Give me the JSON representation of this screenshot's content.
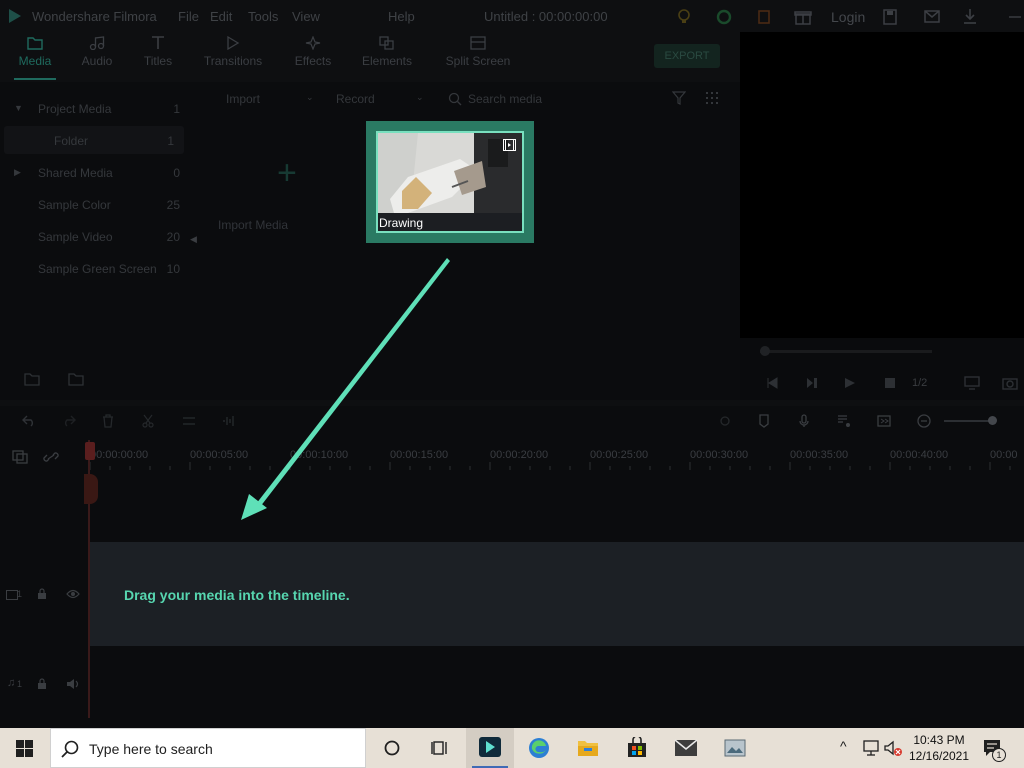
{
  "app": {
    "name": "Wondershare Filmora",
    "menu": [
      "File",
      "Edit",
      "Tools",
      "View",
      "Help"
    ],
    "document_title": "Untitled : 00:00:00:00",
    "login_label": "Login"
  },
  "tabs": [
    {
      "label": "Media",
      "icon": "folder-icon",
      "active": true
    },
    {
      "label": "Audio",
      "icon": "music-icon",
      "active": false
    },
    {
      "label": "Titles",
      "icon": "text-icon",
      "active": false
    },
    {
      "label": "Transitions",
      "icon": "transition-icon",
      "active": false
    },
    {
      "label": "Effects",
      "icon": "effects-icon",
      "active": false
    },
    {
      "label": "Elements",
      "icon": "elements-icon",
      "active": false
    },
    {
      "label": "Split Screen",
      "icon": "split-screen-icon",
      "active": false
    }
  ],
  "export_label": "EXPORT",
  "media_panel": {
    "items": [
      {
        "label": "Project Media",
        "count": "1"
      },
      {
        "label": "Folder",
        "count": "1"
      },
      {
        "label": "Shared Media",
        "count": "0"
      },
      {
        "label": "Sample Color",
        "count": "25"
      },
      {
        "label": "Sample Video",
        "count": "20"
      },
      {
        "label": "Sample Green Screen",
        "count": "10"
      }
    ],
    "import_label": "Import",
    "record_label": "Record",
    "search_placeholder": "Search media",
    "import_media_label": "Import Media"
  },
  "drag_item": {
    "label": "Drawing"
  },
  "preview": {
    "ratio": "1/2"
  },
  "timeline": {
    "ruler": [
      "00:00:00:00",
      "00:00:05:00",
      "00:00:10:00",
      "00:00:15:00",
      "00:00:20:00",
      "00:00:25:00",
      "00:00:30:00",
      "00:00:35:00",
      "00:00:40:00",
      "00:00"
    ],
    "hint": "Drag your media into the timeline.",
    "video_track_label": "1",
    "audio_track_label": "1"
  },
  "taskbar": {
    "search_placeholder": "Type here to search",
    "time": "10:43 PM",
    "date": "12/16/2021",
    "notification_count": "1"
  },
  "colors": {
    "accent": "#57d6b0",
    "drag_frame": "#2a7a63",
    "arrow": "#5fe0b8"
  }
}
